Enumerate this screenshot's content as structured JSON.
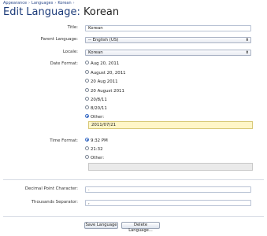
{
  "breadcrumb": [
    "Appearance",
    "Languages",
    "Korean"
  ],
  "page": {
    "title_prefix": "Edit Language:",
    "title_value": "Korean"
  },
  "form": {
    "title_label": "Title:",
    "title_value": "Korean",
    "parent_label": "Parent Language:",
    "parent_value": "-- English (US)",
    "locale_label": "Locale:",
    "locale_value": "Korean",
    "date_format_label": "Date Format:",
    "date_options": [
      {
        "label": "Aug 20, 2011",
        "selected": false
      },
      {
        "label": "August 20, 2011",
        "selected": false
      },
      {
        "label": "20 Aug 2011",
        "selected": false
      },
      {
        "label": "20 August 2011",
        "selected": false
      },
      {
        "label": "20/8/11",
        "selected": false
      },
      {
        "label": "8/20/11",
        "selected": false
      },
      {
        "label": "Other:",
        "selected": true
      }
    ],
    "date_other_value": "2011/07/21",
    "time_format_label": "Time Format:",
    "time_options": [
      {
        "label": "9:32 PM",
        "selected": true
      },
      {
        "label": "21:32",
        "selected": false
      },
      {
        "label": "Other:",
        "selected": false
      }
    ],
    "time_other_value": "",
    "decimal_label": "Decimal Point Character:",
    "decimal_value": ".",
    "thousands_label": "Thousands Separator:",
    "thousands_value": ","
  },
  "buttons": {
    "save": "Save Language",
    "delete": "Delete Language..."
  },
  "colors": {
    "accent": "#2e5fb8",
    "highlight": "#fff6c8",
    "title": "#1d3c7a"
  }
}
